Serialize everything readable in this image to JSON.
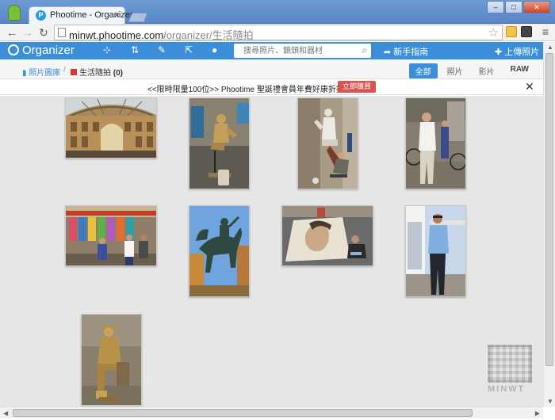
{
  "browser": {
    "tab_title": "Phootime - Organizer",
    "tab_favicon": "P",
    "url_host": "minwt.phootime.com",
    "url_path": "/organizer/生活隨拍"
  },
  "app": {
    "brand": "Organizer",
    "search_placeholder": "搜尋照片、鏡頭和器材",
    "guide_label": "新手指南",
    "upload_label": "上傳照片",
    "accent_color": "#3b8fd9"
  },
  "breadcrumb": {
    "root": "照片圖庫",
    "separator": "/",
    "current": "生活隨拍",
    "count": "(0)"
  },
  "filters": [
    {
      "label": "全部",
      "active": true
    },
    {
      "label": "照片",
      "active": false
    },
    {
      "label": "影片",
      "active": false
    },
    {
      "label": "RAW",
      "active": false
    }
  ],
  "notice": {
    "text": "<<限時限量100位>> Phootime 聖誕禮會員年費好康折扣加碼送",
    "button": "立即購買",
    "close": "✕"
  },
  "gallery": {
    "photos": [
      {
        "name": "photo-galleria-arcade"
      },
      {
        "name": "photo-levitating-golden-performer"
      },
      {
        "name": "photo-street-performer-on-pillar"
      },
      {
        "name": "photo-man-with-bicycles"
      },
      {
        "name": "photo-street-market-stall"
      },
      {
        "name": "photo-equestrian-statue"
      },
      {
        "name": "photo-street-chalk-art"
      },
      {
        "name": "photo-man-by-bus"
      },
      {
        "name": "photo-golden-statue-performer"
      }
    ]
  },
  "watermark": {
    "text": "MINWT"
  }
}
